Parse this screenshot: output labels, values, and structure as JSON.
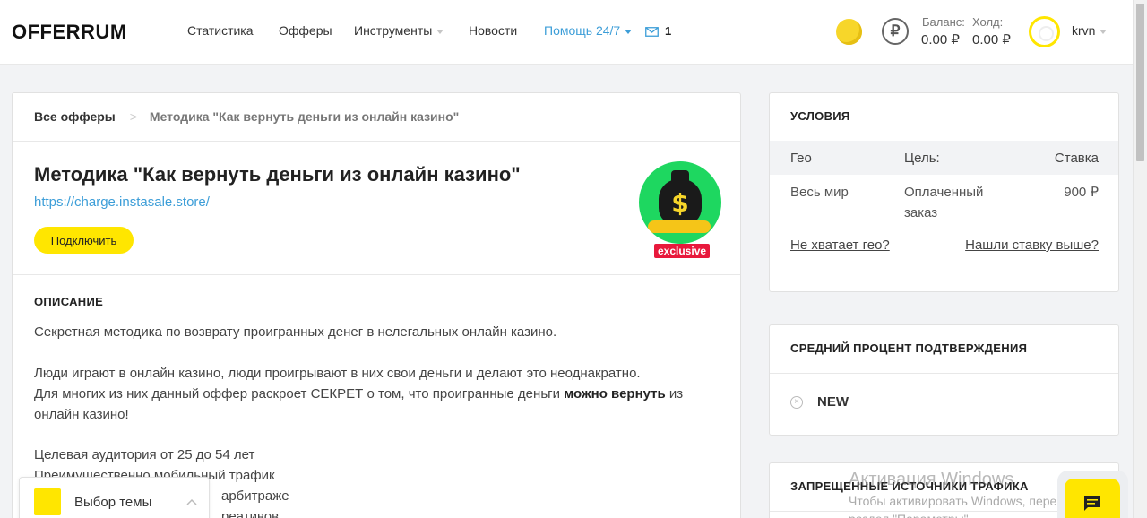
{
  "header": {
    "logo": "OFFERRUM",
    "nav": [
      "Статистика",
      "Офферы",
      "Инструменты",
      "Новости",
      "Помощь 24/7"
    ],
    "messages_count": "1",
    "balance_label": "Баланс:",
    "balance_value": "0.00 ₽",
    "hold_label": "Холд:",
    "hold_value": "0.00 ₽",
    "ruble_symbol": "₽",
    "username": "krvn"
  },
  "breadcrumb": {
    "root": "Все офферы",
    "current": "Методика \"Как вернуть деньги из онлайн казино\""
  },
  "offer": {
    "title": "Методика \"Как вернуть деньги из онлайн казино\"",
    "link": "https://charge.instasale.store/",
    "connect_label": "Подключить",
    "badge": "exclusive",
    "image_icon": "money-bag-icon"
  },
  "description": {
    "title": "ОПИСАНИЕ",
    "p1": "Секретная методика по возврату проигранных денег в нелегальных онлайн казино.",
    "p2_line1": "Люди играют в онлайн казино, люди проигрывают в них свои деньги и делают это неоднакратно.",
    "p2_line2_pre": "Для многих из них данный оффер раскроет СЕКРЕТ о том, что проигранные деньги ",
    "p2_line2_bold": "можно вернуть",
    "p2_line2_post": " из",
    "p2_line3": "онлайн казино!",
    "p3_line1": "Целевая аудитория от 25 до 54 лет",
    "p3_line2": "Преимущественно мобильный трафик",
    "p3_line3": "арбитраже",
    "p3_line4": "реативов"
  },
  "conditions": {
    "title": "УСЛОВИЯ",
    "col_geo": "Гео",
    "col_goal": "Цель:",
    "col_rate": "Ставка",
    "geo": "Весь мир",
    "goal_line1": "Оплаченный",
    "goal_line2": "заказ",
    "rate": "900 ₽",
    "link_geo": "Не хватает гео?",
    "link_rate": "Нашли ставку выше?"
  },
  "approval": {
    "title": "СРЕДНИЙ ПРОЦЕНТ ПОДТВЕРЖДЕНИЯ",
    "value": "NEW"
  },
  "forbidden": {
    "title": "ЗАПРЕЩЕННЫЕ ИСТОЧНИКИ ТРАФИКА"
  },
  "theme_widget": {
    "label": "Выбор темы",
    "color": "#ffe600"
  },
  "windows_watermark": {
    "title": "Активация Windows",
    "line1": "Чтобы активировать Windows, перейдите в",
    "line2": "раздел \"Параметры\"."
  },
  "colors": {
    "accent": "#ffe600",
    "link": "#3d9ed8",
    "badge": "#e8193c"
  }
}
